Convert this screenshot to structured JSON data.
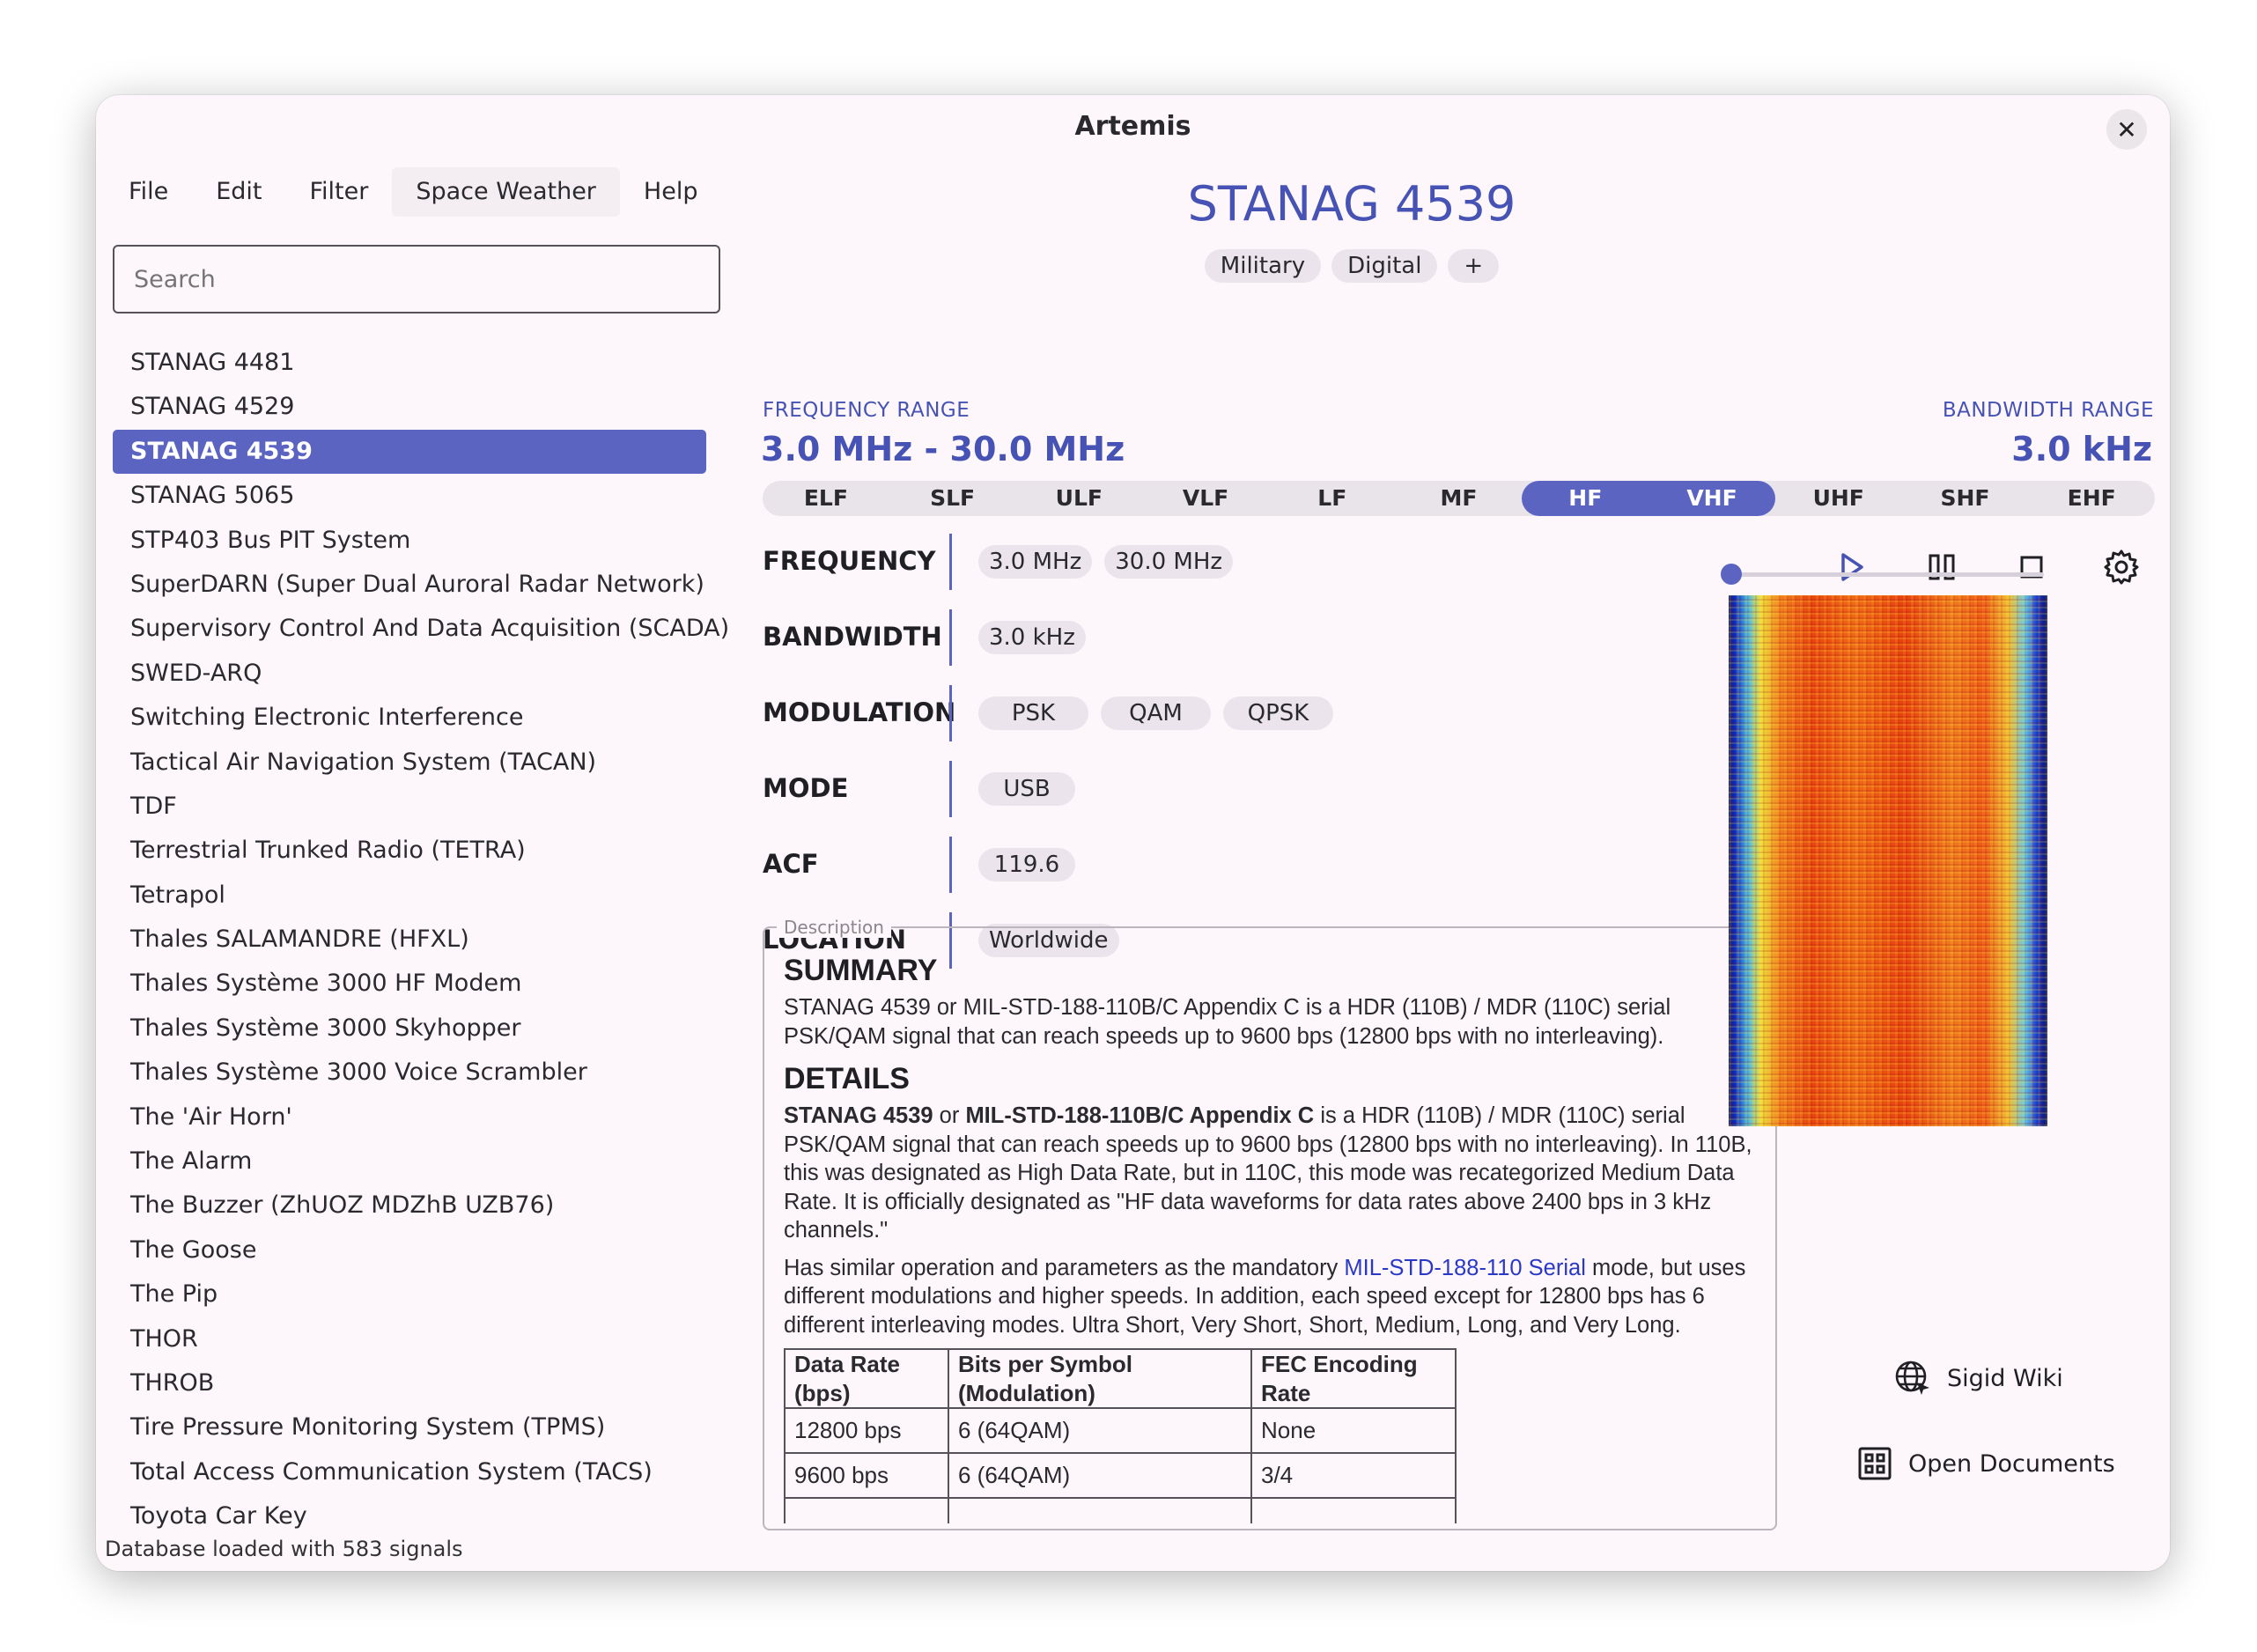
{
  "window": {
    "title": "Artemis"
  },
  "menu": [
    "File",
    "Edit",
    "Filter",
    "Space Weather",
    "Help"
  ],
  "search": {
    "placeholder": "Search",
    "value": ""
  },
  "signals": [
    "STANAG 4481",
    "STANAG 4529",
    "STANAG 4539",
    "STANAG 5065",
    "STP403 Bus PIT System",
    "SuperDARN (Super Dual Auroral Radar Network)",
    "Supervisory Control And Data Acquisition (SCADA)",
    "SWED-ARQ",
    "Switching Electronic Interference",
    "Tactical Air Navigation System (TACAN)",
    "TDF",
    "Terrestrial Trunked Radio (TETRA)",
    "Tetrapol",
    "Thales SALAMANDRE (HFXL)",
    "Thales Système 3000 HF Modem",
    "Thales Système 3000 Skyhopper",
    "Thales Système 3000 Voice Scrambler",
    "The 'Air Horn'",
    "The Alarm",
    "The Buzzer (ZhUOZ MDZhB UZB76)",
    "The Goose",
    "The Pip",
    "THOR",
    "THROB",
    "Tire Pressure Monitoring System (TPMS)",
    "Total Access Communication System (TACS)",
    "Toyota Car Key"
  ],
  "selected_signal_index": 2,
  "status": "Database loaded with 583 signals",
  "signal": {
    "name": "STANAG 4539",
    "tags": [
      "Military",
      "Digital",
      "+"
    ],
    "frequency_range_label": "FREQUENCY RANGE",
    "frequency_range_value": "3.0 MHz - 30.0 MHz",
    "bandwidth_range_label": "BANDWIDTH RANGE",
    "bandwidth_range_value": "3.0 kHz",
    "bands": [
      "ELF",
      "SLF",
      "ULF",
      "VLF",
      "LF",
      "MF",
      "HF",
      "VHF",
      "UHF",
      "SHF",
      "EHF"
    ],
    "active_bands": [
      "HF",
      "VHF"
    ],
    "properties": [
      {
        "label": "FREQUENCY",
        "values": [
          "3.0 MHz",
          "30.0 MHz"
        ]
      },
      {
        "label": "BANDWIDTH",
        "values": [
          "3.0 kHz"
        ]
      },
      {
        "label": "MODULATION",
        "values": [
          "PSK",
          "QAM",
          "QPSK"
        ]
      },
      {
        "label": "MODE",
        "values": [
          "USB"
        ]
      },
      {
        "label": "ACF",
        "values": [
          "119.6"
        ]
      },
      {
        "label": "LOCATION",
        "values": [
          "Worldwide"
        ]
      }
    ]
  },
  "description": {
    "legend": "Description",
    "summary_heading": "SUMMARY",
    "summary_text": "STANAG 4539 or MIL-STD-188-110B/C Appendix C is a HDR (110B) / MDR (110C) serial PSK/QAM signal that can reach speeds up to 9600 bps (12800 bps with no interleaving).",
    "details_heading": "DETAILS",
    "details_bold_1": "STANAG 4539",
    "details_or": " or ",
    "details_bold_2": "MIL-STD-188-110B/C Appendix C",
    "details_text_1": " is a HDR (110B) / MDR (110C) serial PSK/QAM signal that can reach speeds up to 9600 bps (12800 bps with no interleaving). In 110B, this was designated as High Data Rate, but in 110C, this mode was recategorized Medium Data Rate. It is officially designated as \"HF data waveforms for data rates above 2400 bps in 3 kHz channels.\"",
    "details_text_2a": "Has similar operation and parameters as the mandatory ",
    "details_link": "MIL-STD-188-110 Serial",
    "details_text_2b": " mode, but uses different modulations and higher speeds. In addition, each speed except for 12800 bps has 6 different interleaving modes. Ultra Short, Very Short, Short, Medium, Long, and Very Long.",
    "table_headers": [
      "Data Rate (bps)",
      "Bits per Symbol (Modulation)",
      "FEC Encoding Rate"
    ],
    "table_rows": [
      [
        "12800 bps",
        "6 (64QAM)",
        "None"
      ],
      [
        "9600 bps",
        "6 (64QAM)",
        "3/4"
      ],
      [
        "",
        "",
        ""
      ]
    ]
  },
  "player": {
    "play_icon": "play-icon",
    "pause_icon": "pause-icon",
    "stop_icon": "stop-icon",
    "settings_icon": "gear-icon",
    "position_fraction": 0.02
  },
  "links": {
    "wiki_label": "Sigid Wiki",
    "docs_label": "Open Documents"
  },
  "colors": {
    "accent": "#5c64c2",
    "title": "#4753b4",
    "link": "#2a38c8"
  }
}
